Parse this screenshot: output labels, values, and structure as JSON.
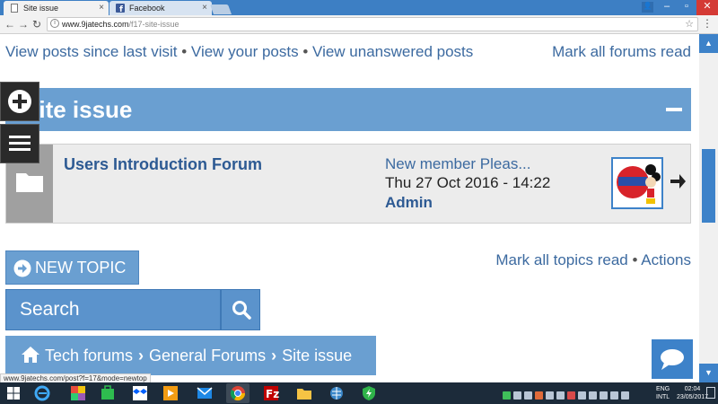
{
  "browser": {
    "tabs": [
      {
        "title": "Site issue",
        "active": true
      },
      {
        "title": "Facebook",
        "active": false
      }
    ],
    "url_host": "www.9jatechs.com",
    "url_path": "/f17-site-issue",
    "status_url": "www.9jatechs.com/post?f=17&mode=newtop"
  },
  "page": {
    "top_links": [
      "View posts since last visit",
      "View your posts",
      "View unanswered posts"
    ],
    "separator": "•",
    "mark_forums_read": "Mark all forums read",
    "forum_title": "Site issue",
    "subforum": {
      "name": "Users Introduction Forum",
      "last_post_title": "New member Pleas...",
      "last_post_date": "Thu 27 Oct 2016 - 14:22",
      "last_post_author": "Admin"
    },
    "new_topic_label": "NEW TOPIC",
    "mark_topics_read": "Mark all topics read",
    "actions_label": "Actions",
    "search_placeholder": "Search",
    "breadcrumbs": [
      "Tech forums",
      "General Forums",
      "Site issue"
    ]
  },
  "taskbar": {
    "lang_top": "ENG",
    "lang_bottom": "INTL",
    "time": "02:04",
    "date": "23/05/2017"
  },
  "colors": {
    "accent": "#6a9fd1",
    "link": "#3c6aa0",
    "scrollbar": "#3d82c9",
    "taskbar": "#1c2b3a"
  }
}
